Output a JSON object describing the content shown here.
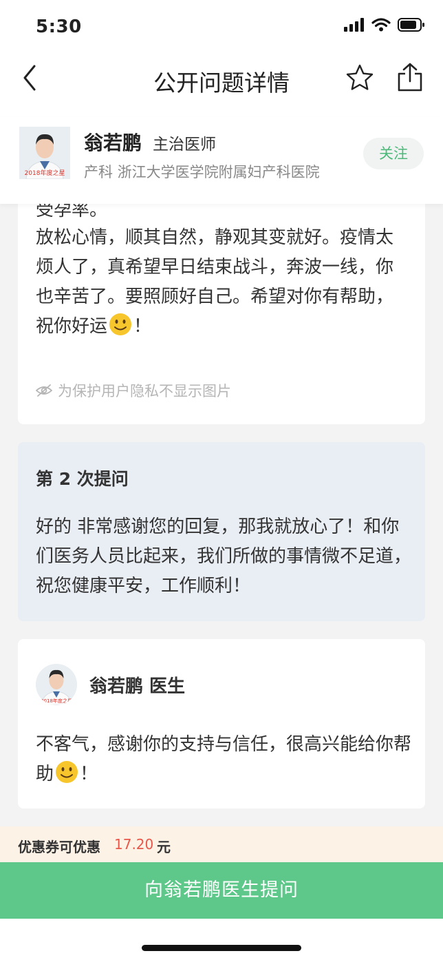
{
  "status": {
    "time": "5:30"
  },
  "nav": {
    "title": "公开问题详情"
  },
  "doctor": {
    "name": "翁若鹏",
    "title": "主治医师",
    "department": "产科 浙江大学医学院附属妇产科医院",
    "follow": "关注",
    "badge": "2018年度之星"
  },
  "answer": {
    "cut_text": "受孕率。",
    "body_main": "放松心情，顺其自然，静观其变就好。疫情太烦人了，真希望早日结束战斗，奔波一线，你也辛苦了。要照顾好自己。希望对你有帮助，祝你好运",
    "body_end": "！",
    "privacy_note": "为保护用户隐私不显示图片"
  },
  "question2": {
    "heading": "第 2 次提问",
    "body": "好的 非常感谢您的回复，那我就放心了！和你们医务人员比起来，我们所做的事情微不足道，祝您健康平安，工作顺利！"
  },
  "reply": {
    "name": "翁若鹏 医生",
    "body_main": "不客气，感谢你的支持与信任，很高兴能给你帮助",
    "body_end": "！"
  },
  "coupon": {
    "prefix": "优惠券可优惠",
    "amount": "17.20",
    "unit": "元"
  },
  "ask_button": "向翁若鹏医生提问",
  "colors": {
    "accent": "#5ec78a",
    "follow_text": "#4cb87a",
    "coupon_amount": "#e8574a",
    "question_bg": "#e9edf4"
  }
}
